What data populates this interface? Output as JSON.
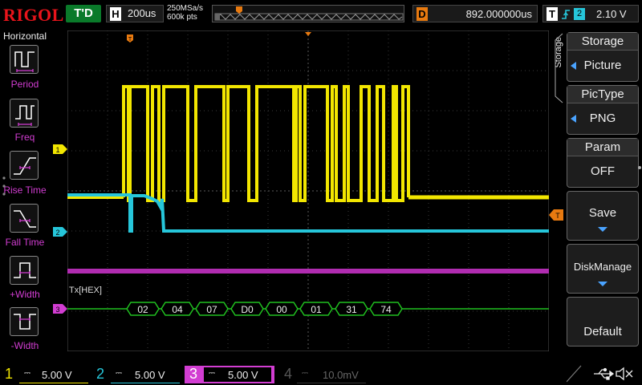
{
  "header": {
    "logo": "RIGOL",
    "trigger_state": "T'D",
    "timebase_letter": "H",
    "timebase": "200us",
    "sample_rate": "250MSa/s",
    "memory_depth": "600k pts",
    "delay_letter": "D",
    "delay": "892.000000us",
    "trigger_letter": "T",
    "trigger_source": "2",
    "trigger_level": "2.10 V"
  },
  "left_menu": {
    "title": "Horizontal",
    "items": [
      {
        "label": "Period",
        "icon": "period-icon"
      },
      {
        "label": "Freq",
        "icon": "freq-icon"
      },
      {
        "label": "Rise Time",
        "icon": "rise-time-icon"
      },
      {
        "label": "Fall Time",
        "icon": "fall-time-icon"
      },
      {
        "label": "+Width",
        "icon": "pos-width-icon"
      },
      {
        "label": "-Width",
        "icon": "neg-width-icon"
      }
    ]
  },
  "right_menu": {
    "side_label": "Storage",
    "items": [
      {
        "head": "Storage",
        "value": "Picture"
      },
      {
        "head": "PicType",
        "value": "PNG"
      },
      {
        "head": "Param",
        "value": "OFF"
      },
      {
        "head": "Save",
        "value": ""
      },
      {
        "head": "DiskManage",
        "value": ""
      },
      {
        "head": "Default",
        "value": ""
      }
    ]
  },
  "waveform": {
    "channel_markers": [
      "1",
      "2",
      "3"
    ],
    "trigger_marker": "T",
    "decode_label": "Tx[HEX]",
    "decode_bytes": [
      "02",
      "04",
      "07",
      "D0",
      "00",
      "01",
      "31",
      "74"
    ]
  },
  "channels": [
    {
      "num": "1",
      "scale": "5.00 V",
      "color": "#f2e600"
    },
    {
      "num": "2",
      "scale": "5.00 V",
      "color": "#26c6da"
    },
    {
      "num": "3",
      "scale": "5.00 V",
      "color": "#d23dd2"
    },
    {
      "num": "4",
      "scale": "10.0mV",
      "color": "#3a5ccc"
    }
  ],
  "colors": {
    "ch1": "#f2e600",
    "ch2": "#26c6da",
    "ch3": "#d23dd2",
    "decode": "#20c020",
    "trigger": "#e87a10"
  }
}
